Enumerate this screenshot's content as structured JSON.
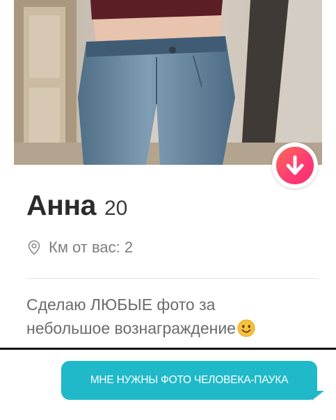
{
  "profile": {
    "name": "Анна",
    "age": "20",
    "distance": "Км от вас: 2",
    "bio_line1": "Сделаю ЛЮБЫЕ фото за",
    "bio_line2": "небольшое вознаграждение"
  },
  "chat": {
    "message": "МНЕ НУЖНЫ ФОТО ЧЕЛОВЕКА-ПАУКА"
  },
  "icons": {
    "info": "arrow-down-icon",
    "location": "location-pin-icon",
    "emoji": "smiling-face-icon"
  },
  "colors": {
    "badge_gradient_start": "#ff6a57",
    "badge_gradient_end": "#f5306f",
    "bubble": "#1fb9c9",
    "name": "#2b2b2b",
    "muted_text": "#7e7e7e"
  }
}
